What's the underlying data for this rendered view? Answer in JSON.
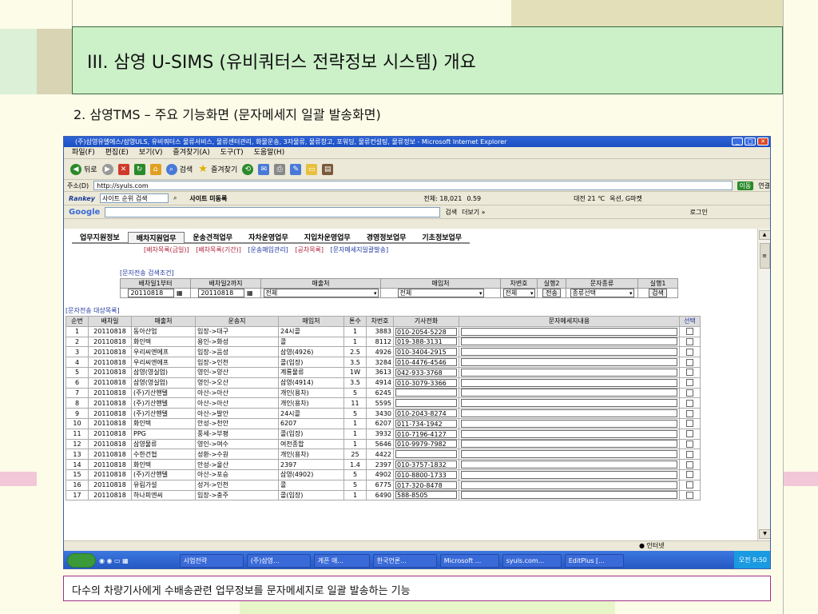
{
  "slide": {
    "title": "III. 삼영 U-SIMS (유비쿼터스 전략정보 시스템) 개요",
    "subtitle": "2. 삼영TMS  – 주요 기능화면 (문자메세지 일괄 발송화면)",
    "caption": "다수의 차량기사에게 수배송관련 업무정보를 문자메세지로 일괄 발송하는 기능"
  },
  "browser": {
    "window_title": "(주)삼영유엘에스/삼영ULS, 유비쿼터스 물류서비스, 물류센터관리, 화물운송, 3자물류, 물류창고, 포워딩, 물류컨설팅, 물류정보 - Microsoft Internet Explorer",
    "menu": [
      "파일(F)",
      "편집(E)",
      "보기(V)",
      "즐겨찾기(A)",
      "도구(T)",
      "도움말(H)"
    ],
    "toolbar": {
      "back": "뒤로",
      "search": "검색",
      "favorites": "즐겨찾기"
    },
    "address_label": "주소(D)",
    "address": "http://syuls.com",
    "go_label": "이동",
    "links_label": "연결",
    "rankey": {
      "brand": "Rankey",
      "search_value": "사이트 순위 검색",
      "site_move": "사이트 미동록",
      "total": "전체: 18,021",
      "pct": "0.59",
      "weather": "대전 21 ℃",
      "market": "옥션, G마켓"
    },
    "google": {
      "brand": "Google",
      "search_btn": "검색",
      "more": "더보기 »",
      "login": "로그인"
    },
    "status": "인터넷"
  },
  "nav": {
    "items": [
      "업무지원정보",
      "배차지원업무",
      "운송견적업무",
      "자차운영업무",
      "지입차운영업무",
      "경영정보업무",
      "기초정보업무"
    ],
    "sub": [
      "[배차목록(금일)]",
      "[배차목록(기간)]",
      "[운송매입관리]",
      "[공차목록]",
      "[문자메세지일괄발송]"
    ]
  },
  "search": {
    "label": "[문자전송 검색조건]",
    "headers": [
      "배차일1부터",
      "배차일2까지",
      "매출처",
      "매입처",
      "차변호",
      "실행2",
      "문자종류",
      "실행1"
    ],
    "date_from": "20110818",
    "date_to": "20110818",
    "seller": "전체",
    "buyer": "전체",
    "car": "전체",
    "send_btn": "전송",
    "msg_type": "종류선택",
    "search_btn": "검색"
  },
  "list": {
    "label": "[문자전송 대상목록]",
    "columns": [
      "순번",
      "배차일",
      "매출처",
      "운송지",
      "매입처",
      "톤수",
      "차번호",
      "기사전화",
      "문자메세지내용",
      "선택"
    ],
    "rows": [
      [
        "1",
        "20110818",
        "동아산업",
        "입장->대구",
        "24시콜",
        "1",
        "3883",
        "010-2054-5228"
      ],
      [
        "2",
        "20110818",
        "화인텍",
        "용인->화성",
        "콜",
        "1",
        "8112",
        "019-388-3131"
      ],
      [
        "3",
        "20110818",
        "우리씨엔에프",
        "입장->음성",
        "삼영(4926)",
        "2.5",
        "4926",
        "010-3404-2915"
      ],
      [
        "4",
        "20110818",
        "우리씨엔에프",
        "입장->인천",
        "콜(입장)",
        "3.5",
        "3284",
        "010-4476-4546"
      ],
      [
        "5",
        "20110818",
        "삼영(영실업)",
        "영인->양산",
        "계룡물류",
        "1W",
        "3613",
        "042-933-3768"
      ],
      [
        "6",
        "20110818",
        "삼영(영실업)",
        "영인->오산",
        "삼영(4914)",
        "3.5",
        "4914",
        "010-3079-3366"
      ],
      [
        "7",
        "20110818",
        "(주)기산핸텔",
        "아산->아산",
        "개인(용차)",
        "5",
        "6245",
        ""
      ],
      [
        "8",
        "20110818",
        "(주)기산핸텔",
        "아산->아산",
        "개인(용차)",
        "11",
        "5595",
        ""
      ],
      [
        "9",
        "20110818",
        "(주)기산핸텔",
        "아산->발안",
        "24시콜",
        "5",
        "3430",
        "010-2043-8274"
      ],
      [
        "10",
        "20110818",
        "화인텍",
        "안성->천안",
        "6207",
        "1",
        "6207",
        "011-734-1942"
      ],
      [
        "11",
        "20110818",
        "PPG",
        "풍세->부평",
        "콜(입장)",
        "1",
        "3932",
        "010-7196-4127"
      ],
      [
        "12",
        "20110818",
        "삼영물류",
        "영인->여수",
        "여천종합",
        "1",
        "5646",
        "010-9979-7982"
      ],
      [
        "13",
        "20110818",
        "수한건협",
        "성환->수원",
        "개인(용차)",
        "25",
        "4422",
        ""
      ],
      [
        "14",
        "20110818",
        "화인텍",
        "안성->울산",
        "2397",
        "1.4",
        "2397",
        "010-3757-1832"
      ],
      [
        "15",
        "20110818",
        "(주)기산핸텔",
        "아산->포승",
        "삼영(4902)",
        "5",
        "4902",
        "010-8800-1733"
      ],
      [
        "16",
        "20110818",
        "유림가설",
        "성거->인천",
        "콜",
        "5",
        "6775",
        "017-320-8478"
      ],
      [
        "17",
        "20110818",
        "하나피엔씨",
        "입장->충주",
        "콜(입장)",
        "1",
        "6490",
        "588-8505"
      ]
    ]
  },
  "taskbar": {
    "tasks": [
      "사업전략",
      "(주)삼영...",
      "게픈 애...",
      "한국언론...",
      "Microsoft ...",
      "syuls.com...",
      "EditPlus [..."
    ],
    "clock": "오전 9:50"
  }
}
